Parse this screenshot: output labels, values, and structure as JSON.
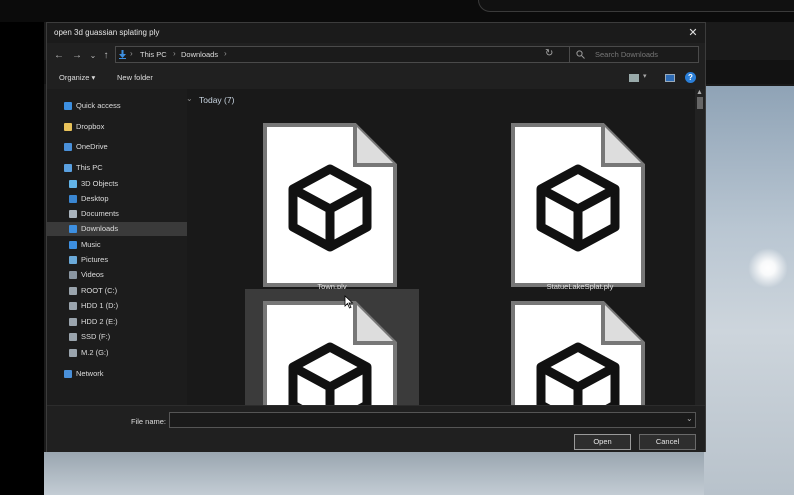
{
  "dialog": {
    "title": "open 3d guassian splating ply",
    "close_glyph": "✕"
  },
  "nav": {
    "back_glyph": "←",
    "forward_glyph": "→",
    "recent_glyph": "⌄",
    "up_glyph": "↑",
    "address_drop_glyph": "⌄",
    "refresh_glyph": "↻",
    "breadcrumb": [
      "This PC",
      "Downloads"
    ],
    "breadcrumb_sep": "›",
    "search_placeholder": "Search Downloads"
  },
  "toolbar": {
    "organize_label": "Organize ▾",
    "new_folder_label": "New folder",
    "view_drop_glyph": "▾",
    "help_glyph": "?"
  },
  "sidebar": {
    "items": [
      {
        "label": "Quick access",
        "icon": "star-icon",
        "color": "#3d8fe0",
        "indent": 1
      },
      {
        "label": "Dropbox",
        "icon": "dropbox-folder-icon",
        "color": "#e8c25a",
        "indent": 1
      },
      {
        "label": "OneDrive",
        "icon": "onedrive-cloud-icon",
        "color": "#4a90d9",
        "indent": 1
      },
      {
        "label": "This PC",
        "icon": "monitor-icon",
        "color": "#5aa0e0",
        "indent": 1
      },
      {
        "label": "3D Objects",
        "icon": "3d-objects-icon",
        "color": "#62b3e8",
        "indent": 2
      },
      {
        "label": "Desktop",
        "icon": "desktop-icon",
        "color": "#3a86d1",
        "indent": 2
      },
      {
        "label": "Documents",
        "icon": "documents-icon",
        "color": "#a9b3bd",
        "indent": 2
      },
      {
        "label": "Downloads",
        "icon": "downloads-icon",
        "color": "#3d8fe0",
        "indent": 2,
        "selected": true
      },
      {
        "label": "Music",
        "icon": "music-icon",
        "color": "#3d8fe0",
        "indent": 2
      },
      {
        "label": "Pictures",
        "icon": "pictures-icon",
        "color": "#6aa9d8",
        "indent": 2
      },
      {
        "label": "Videos",
        "icon": "videos-icon",
        "color": "#8a96a2",
        "indent": 2
      },
      {
        "label": "ROOT (C:)",
        "icon": "drive-icon",
        "color": "#9aa4ad",
        "indent": 2
      },
      {
        "label": "HDD 1 (D:)",
        "icon": "drive-icon",
        "color": "#9aa4ad",
        "indent": 2
      },
      {
        "label": "HDD 2 (E:)",
        "icon": "drive-icon",
        "color": "#9aa4ad",
        "indent": 2
      },
      {
        "label": "SSD (F:)",
        "icon": "drive-icon",
        "color": "#9aa4ad",
        "indent": 2
      },
      {
        "label": "M.2 (G:)",
        "icon": "drive-icon",
        "color": "#9aa4ad",
        "indent": 2
      },
      {
        "label": "Network",
        "icon": "network-icon",
        "color": "#4a90d9",
        "indent": 1
      }
    ]
  },
  "content": {
    "group_chevron": "⌄",
    "group_title": "Today (7)",
    "files": [
      {
        "name": "Town.ply",
        "icon": "3d-file-icon",
        "hovered": false
      },
      {
        "name": "StatueLakeSplat.ply",
        "icon": "3d-file-icon",
        "hovered": false
      },
      {
        "name": "",
        "icon": "3d-file-icon",
        "hovered": true
      },
      {
        "name": "",
        "icon": "3d-file-icon",
        "hovered": false
      }
    ],
    "scroll_up_glyph": "▲"
  },
  "footer": {
    "file_name_label": "File name:",
    "file_name_value": "",
    "file_name_drop_glyph": "⌄",
    "open_label": "Open",
    "cancel_label": "Cancel"
  },
  "colors": {
    "dialog_bg": "#202020",
    "selection": "#3a3a3a",
    "accent": "#2b7fd8"
  }
}
